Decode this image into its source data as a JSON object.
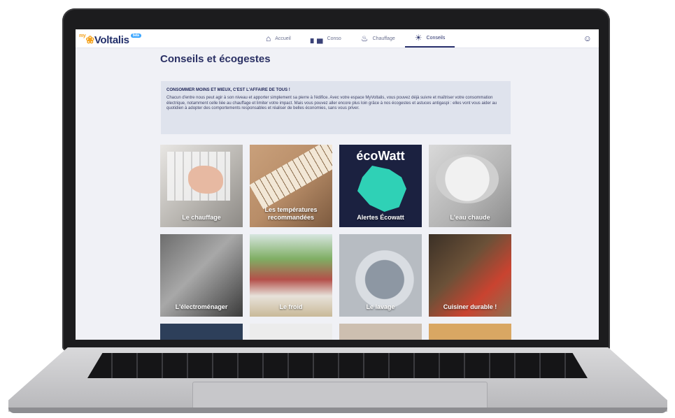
{
  "app": {
    "logo_prefix": "my",
    "logo": "Voltalis",
    "logo_badge": "beta"
  },
  "nav": [
    {
      "label": "Accueil",
      "icon": "home-icon",
      "active": false
    },
    {
      "label": "Conso",
      "icon": "consumption-chart-icon",
      "active": false
    },
    {
      "label": "Chauffage",
      "icon": "heating-icon",
      "active": false
    },
    {
      "label": "Conseils",
      "icon": "lightbulb-icon",
      "active": true
    }
  ],
  "page": {
    "title": "Conseils et écogestes"
  },
  "intro": {
    "heading": "CONSOMMER MOINS ET MIEUX, C'EST L'AFFAIRE DE TOUS !",
    "text": "Chacun d'entre nous peut agir à son niveau et apporter simplement sa pierre à l'édifice. Avec votre espace MyVoltalis, vous pouvez déjà suivre et maîtriser votre consommation électrique, notamment celle liée au chauffage et limiter votre impact. Mais vous pouvez aller encore plus loin grâce à nos écogestes et astuces antigaspi : elles vont vous aider au quotidien à adopter des comportements responsables et réaliser de belles économies, sans vous priver."
  },
  "tiles": [
    {
      "label": "Le chauffage"
    },
    {
      "label": "Les températures recommandées"
    },
    {
      "label": "Alertes Écowatt",
      "brand": "écoWatt"
    },
    {
      "label": "L'eau chaude"
    },
    {
      "label": "L'électroménager"
    },
    {
      "label": "Le froid"
    },
    {
      "label": "Le lavage"
    },
    {
      "label": "Cuisiner durable !"
    }
  ]
}
